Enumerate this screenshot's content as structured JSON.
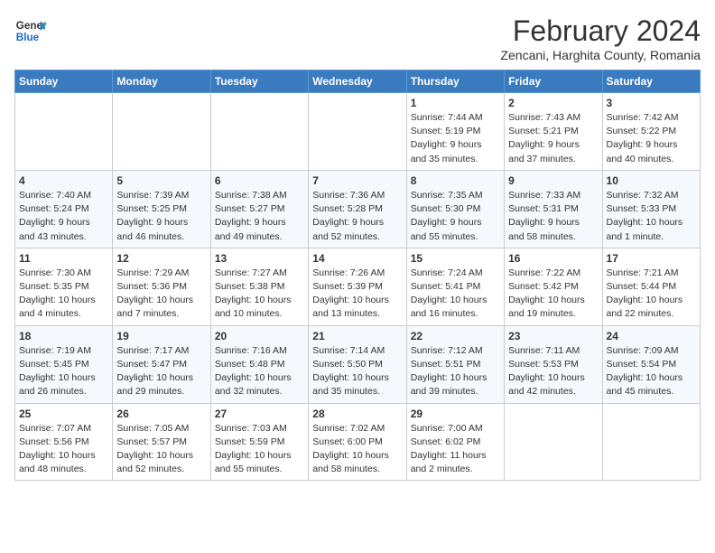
{
  "logo": {
    "general": "General",
    "blue": "Blue"
  },
  "header": {
    "month_title": "February 2024",
    "subtitle": "Zencani, Harghita County, Romania"
  },
  "days_of_week": [
    "Sunday",
    "Monday",
    "Tuesday",
    "Wednesday",
    "Thursday",
    "Friday",
    "Saturday"
  ],
  "weeks": [
    {
      "cells": [
        {
          "day": "",
          "info": ""
        },
        {
          "day": "",
          "info": ""
        },
        {
          "day": "",
          "info": ""
        },
        {
          "day": "",
          "info": ""
        },
        {
          "day": "1",
          "info": "Sunrise: 7:44 AM\nSunset: 5:19 PM\nDaylight: 9 hours\nand 35 minutes."
        },
        {
          "day": "2",
          "info": "Sunrise: 7:43 AM\nSunset: 5:21 PM\nDaylight: 9 hours\nand 37 minutes."
        },
        {
          "day": "3",
          "info": "Sunrise: 7:42 AM\nSunset: 5:22 PM\nDaylight: 9 hours\nand 40 minutes."
        }
      ]
    },
    {
      "cells": [
        {
          "day": "4",
          "info": "Sunrise: 7:40 AM\nSunset: 5:24 PM\nDaylight: 9 hours\nand 43 minutes."
        },
        {
          "day": "5",
          "info": "Sunrise: 7:39 AM\nSunset: 5:25 PM\nDaylight: 9 hours\nand 46 minutes."
        },
        {
          "day": "6",
          "info": "Sunrise: 7:38 AM\nSunset: 5:27 PM\nDaylight: 9 hours\nand 49 minutes."
        },
        {
          "day": "7",
          "info": "Sunrise: 7:36 AM\nSunset: 5:28 PM\nDaylight: 9 hours\nand 52 minutes."
        },
        {
          "day": "8",
          "info": "Sunrise: 7:35 AM\nSunset: 5:30 PM\nDaylight: 9 hours\nand 55 minutes."
        },
        {
          "day": "9",
          "info": "Sunrise: 7:33 AM\nSunset: 5:31 PM\nDaylight: 9 hours\nand 58 minutes."
        },
        {
          "day": "10",
          "info": "Sunrise: 7:32 AM\nSunset: 5:33 PM\nDaylight: 10 hours\nand 1 minute."
        }
      ]
    },
    {
      "cells": [
        {
          "day": "11",
          "info": "Sunrise: 7:30 AM\nSunset: 5:35 PM\nDaylight: 10 hours\nand 4 minutes."
        },
        {
          "day": "12",
          "info": "Sunrise: 7:29 AM\nSunset: 5:36 PM\nDaylight: 10 hours\nand 7 minutes."
        },
        {
          "day": "13",
          "info": "Sunrise: 7:27 AM\nSunset: 5:38 PM\nDaylight: 10 hours\nand 10 minutes."
        },
        {
          "day": "14",
          "info": "Sunrise: 7:26 AM\nSunset: 5:39 PM\nDaylight: 10 hours\nand 13 minutes."
        },
        {
          "day": "15",
          "info": "Sunrise: 7:24 AM\nSunset: 5:41 PM\nDaylight: 10 hours\nand 16 minutes."
        },
        {
          "day": "16",
          "info": "Sunrise: 7:22 AM\nSunset: 5:42 PM\nDaylight: 10 hours\nand 19 minutes."
        },
        {
          "day": "17",
          "info": "Sunrise: 7:21 AM\nSunset: 5:44 PM\nDaylight: 10 hours\nand 22 minutes."
        }
      ]
    },
    {
      "cells": [
        {
          "day": "18",
          "info": "Sunrise: 7:19 AM\nSunset: 5:45 PM\nDaylight: 10 hours\nand 26 minutes."
        },
        {
          "day": "19",
          "info": "Sunrise: 7:17 AM\nSunset: 5:47 PM\nDaylight: 10 hours\nand 29 minutes."
        },
        {
          "day": "20",
          "info": "Sunrise: 7:16 AM\nSunset: 5:48 PM\nDaylight: 10 hours\nand 32 minutes."
        },
        {
          "day": "21",
          "info": "Sunrise: 7:14 AM\nSunset: 5:50 PM\nDaylight: 10 hours\nand 35 minutes."
        },
        {
          "day": "22",
          "info": "Sunrise: 7:12 AM\nSunset: 5:51 PM\nDaylight: 10 hours\nand 39 minutes."
        },
        {
          "day": "23",
          "info": "Sunrise: 7:11 AM\nSunset: 5:53 PM\nDaylight: 10 hours\nand 42 minutes."
        },
        {
          "day": "24",
          "info": "Sunrise: 7:09 AM\nSunset: 5:54 PM\nDaylight: 10 hours\nand 45 minutes."
        }
      ]
    },
    {
      "cells": [
        {
          "day": "25",
          "info": "Sunrise: 7:07 AM\nSunset: 5:56 PM\nDaylight: 10 hours\nand 48 minutes."
        },
        {
          "day": "26",
          "info": "Sunrise: 7:05 AM\nSunset: 5:57 PM\nDaylight: 10 hours\nand 52 minutes."
        },
        {
          "day": "27",
          "info": "Sunrise: 7:03 AM\nSunset: 5:59 PM\nDaylight: 10 hours\nand 55 minutes."
        },
        {
          "day": "28",
          "info": "Sunrise: 7:02 AM\nSunset: 6:00 PM\nDaylight: 10 hours\nand 58 minutes."
        },
        {
          "day": "29",
          "info": "Sunrise: 7:00 AM\nSunset: 6:02 PM\nDaylight: 11 hours\nand 2 minutes."
        },
        {
          "day": "",
          "info": ""
        },
        {
          "day": "",
          "info": ""
        }
      ]
    }
  ]
}
